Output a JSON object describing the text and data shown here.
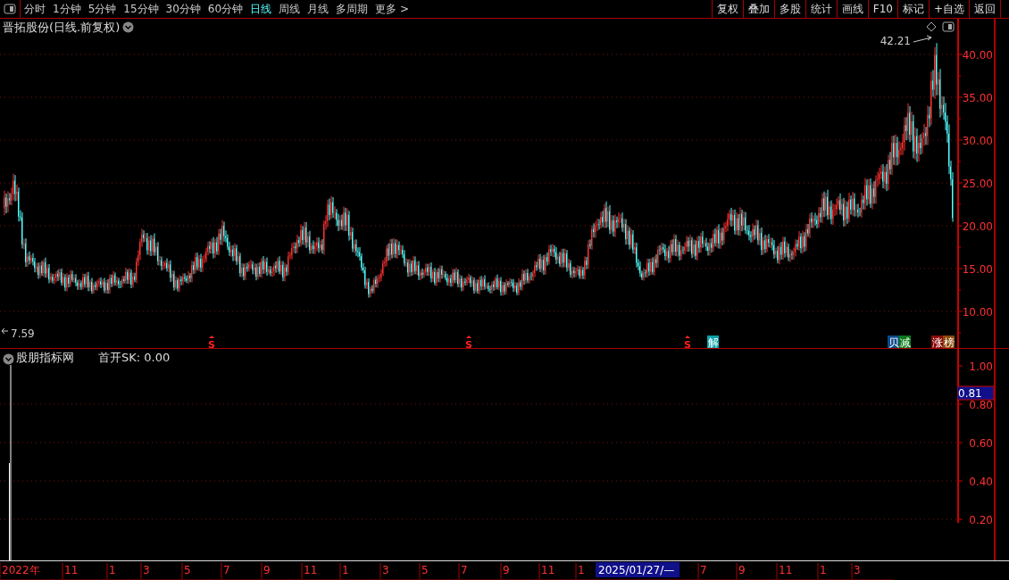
{
  "toolbar": {
    "tabs": [
      {
        "label": "分时",
        "selected": false
      },
      {
        "label": "1分钟",
        "selected": false
      },
      {
        "label": "5分钟",
        "selected": false
      },
      {
        "label": "15分钟",
        "selected": false
      },
      {
        "label": "30分钟",
        "selected": false
      },
      {
        "label": "60分钟",
        "selected": false
      },
      {
        "label": "日线",
        "selected": true
      },
      {
        "label": "周线",
        "selected": false
      },
      {
        "label": "月线",
        "selected": false
      },
      {
        "label": "多周期",
        "selected": false
      },
      {
        "label": "更多 >",
        "selected": false
      }
    ],
    "buttons": [
      "复权",
      "叠加",
      "多股",
      "统计",
      "画线",
      "F10",
      "标记",
      "+自选",
      "返回"
    ]
  },
  "main_chart": {
    "title": "晋拓股份(日线.前复权)",
    "high_label": "42.21",
    "low_label": "7.59",
    "y_ticks": [
      "40.00",
      "35.00",
      "30.00",
      "25.00",
      "20.00",
      "15.00",
      "10.00"
    ],
    "markers": [
      {
        "kind": "signal",
        "text": "S"
      },
      {
        "kind": "signal",
        "text": "S"
      },
      {
        "kind": "signal",
        "text": "S"
      },
      {
        "kind": "tag",
        "text": "解",
        "color": "#0aa0a8"
      },
      {
        "kind": "tag",
        "text": "贝",
        "color": "#0a4a8a"
      },
      {
        "kind": "tag",
        "text": "减",
        "color": "#0a7a1a"
      },
      {
        "kind": "tag",
        "text": "涨",
        "color": "#8a0a0a"
      },
      {
        "kind": "tag",
        "text": "榜",
        "color": "#8a4a0a"
      }
    ]
  },
  "indicator": {
    "title": "股朋指标网",
    "reading": "首开SK: 0.00",
    "y_ticks": [
      "1.00",
      "0.80",
      "0.60",
      "0.40",
      "0.20"
    ],
    "cursor_value": "0.81"
  },
  "date_axis": {
    "labels": [
      "2022年",
      "11",
      "1",
      "3",
      "5",
      "7",
      "9",
      "11",
      "1",
      "3",
      "5",
      "7",
      "9",
      "11",
      "1"
    ],
    "cursor_date": "2025/01/27/—",
    "labels_after": [
      "7",
      "9",
      "11",
      "1",
      "3"
    ]
  }
}
